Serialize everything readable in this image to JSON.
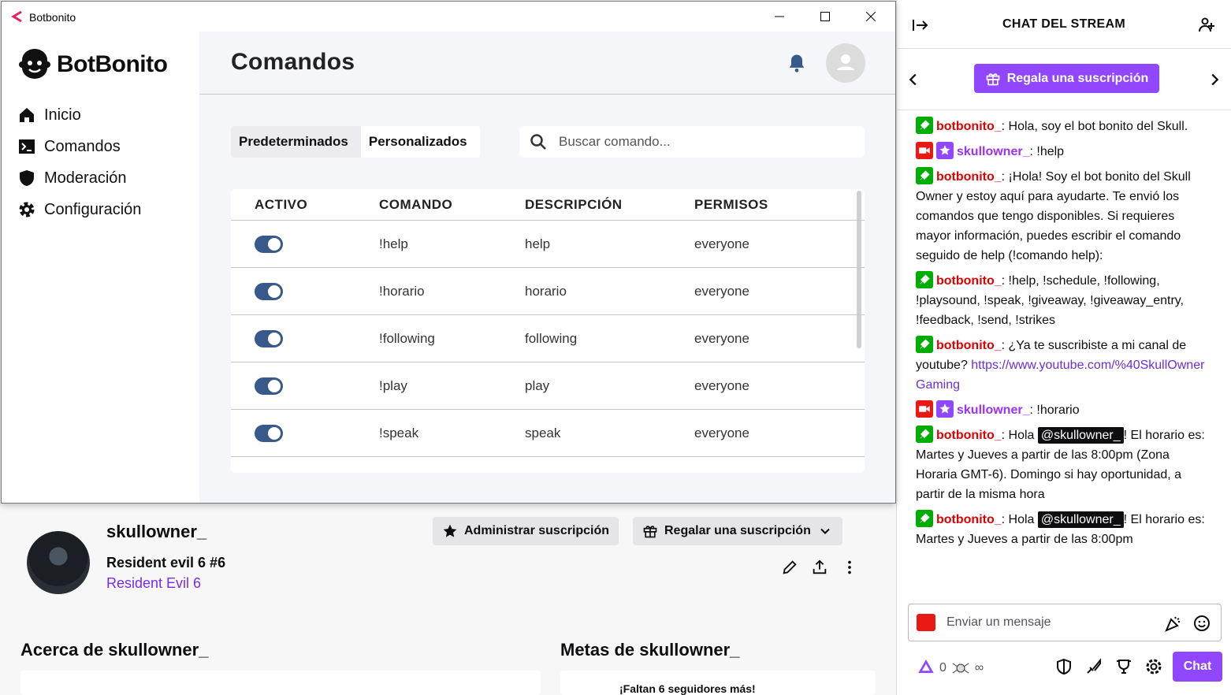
{
  "app": {
    "window_title": "Botbonito",
    "logo_text": "BotBonito",
    "nav": [
      {
        "label": "Inicio",
        "icon": "home-icon"
      },
      {
        "label": "Comandos",
        "icon": "terminal-icon"
      },
      {
        "label": "Moderación",
        "icon": "shield-icon"
      },
      {
        "label": "Configuración",
        "icon": "gear-icon"
      }
    ],
    "page_title": "Comandos",
    "tabs": [
      "Predeterminados",
      "Personalizados"
    ],
    "search_placeholder": "Buscar comando...",
    "table": {
      "headers": [
        "ACTIVO",
        "COMANDO",
        "DESCRIPCIÓN",
        "PERMISOS"
      ],
      "rows": [
        {
          "active": true,
          "command": "!help",
          "description": "help",
          "permissions": "everyone"
        },
        {
          "active": true,
          "command": "!horario",
          "description": "horario",
          "permissions": "everyone"
        },
        {
          "active": true,
          "command": "!following",
          "description": "following",
          "permissions": "everyone"
        },
        {
          "active": true,
          "command": "!play",
          "description": "play",
          "permissions": "everyone"
        },
        {
          "active": true,
          "command": "!speak",
          "description": "speak",
          "permissions": "everyone"
        }
      ]
    },
    "accent_color": "#375a8a"
  },
  "channel": {
    "name": "skullowner_",
    "stream_title": "Resident evil 6 #6",
    "game": "Resident Evil 6",
    "manage_sub": "Administrar suscripción",
    "gift_sub": "Regalar una suscripción",
    "about_title": "Acerca de skullowner_",
    "goals_title": "Metas de skullowner_",
    "goal_text": "¡Faltan 6 seguidores más!"
  },
  "chat": {
    "title": "CHAT DEL STREAM",
    "gift_button": "Regala una suscripción",
    "input_placeholder": "Enviar un mensaje",
    "points": "0",
    "infinity": "∞",
    "send_button": "Chat",
    "brand_color": "#9147ff",
    "messages": [
      {
        "user": "botbonito_",
        "type": "bot",
        "text": ": Hola, soy el bot bonito del Skull."
      },
      {
        "user": "skullowner_",
        "type": "owner",
        "text": ": !help"
      },
      {
        "user": "botbonito_",
        "type": "bot",
        "text": ": ¡Hola! Soy el bot bonito del Skull Owner y estoy aquí para ayudarte. Te envió los comandos que tengo disponibles. Si requieres mayor información, puedes escribir el comando seguido de help (!comando help):"
      },
      {
        "user": "botbonito_",
        "type": "bot",
        "text": ": !help, !schedule, !following, !playsound, !speak, !giveaway, !giveaway_entry, !feedback, !send, !strikes"
      },
      {
        "user": "botbonito_",
        "type": "bot",
        "text": ": ¿Ya te suscribiste a mi canal de youtube? ",
        "link": "https://www.youtube.com/%40SkullOwnerGaming"
      },
      {
        "user": "skullowner_",
        "type": "owner",
        "text": ": !horario"
      },
      {
        "user": "botbonito_",
        "type": "bot",
        "text_pre": ": Hola ",
        "mention": "@skullowner_",
        "text": "! El horario es: Martes y Jueves a partir de las 8:00pm (Zona Horaria GMT-6). Domingo si hay oportunidad, a partir de la misma hora"
      },
      {
        "user": "botbonito_",
        "type": "bot",
        "text_pre": ": Hola ",
        "mention": "@skullowner_",
        "text": "! El horario es: Martes y Jueves a partir de las 8:00pm"
      }
    ]
  }
}
